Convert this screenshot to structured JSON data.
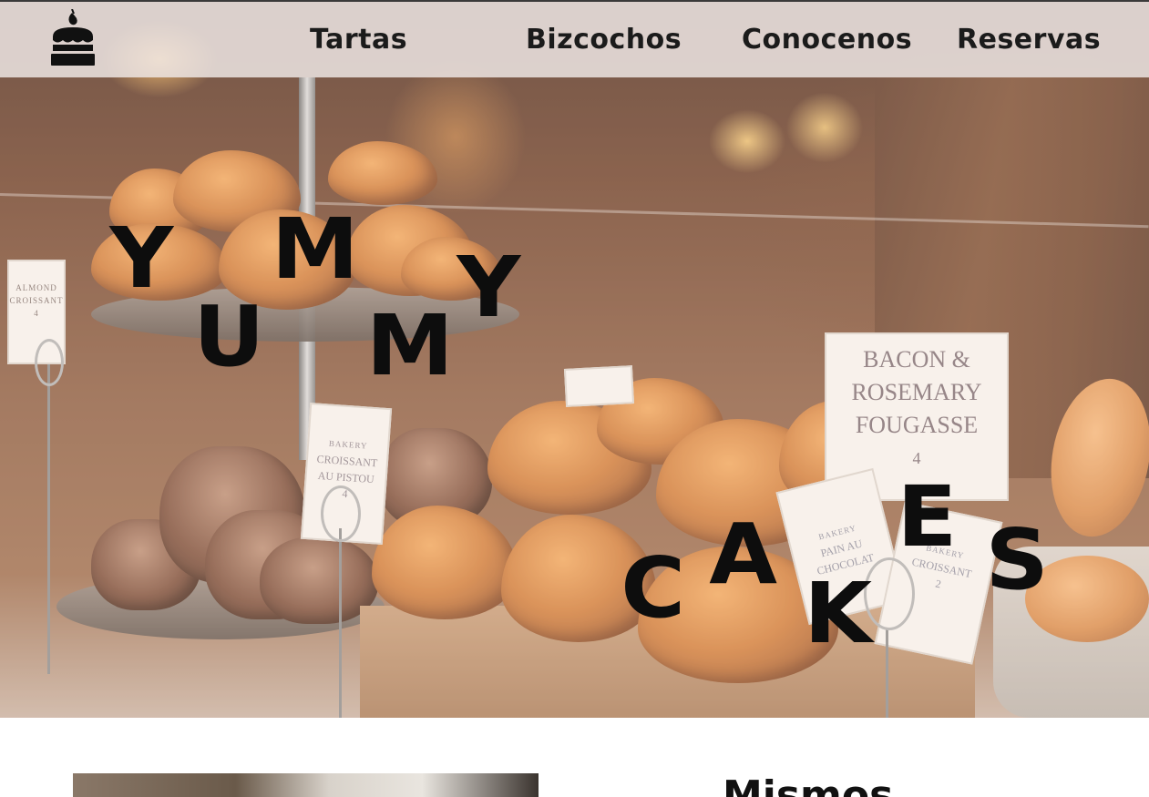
{
  "nav": {
    "logo_icon": "cake-icon",
    "links": [
      "Tartas",
      "Bizcochos",
      "Conocenos",
      "Reservas"
    ]
  },
  "hero": {
    "word1_letters": [
      "Y",
      "U",
      "M",
      "M",
      "Y"
    ],
    "word2_letters": [
      "C",
      "A",
      "K",
      "E",
      "S"
    ],
    "signs": {
      "almond": [
        "ALMOND",
        "CROISSANT",
        "4"
      ],
      "pistou": [
        "BAKERY",
        "CROISSANT",
        "AU PISTOU",
        "4"
      ],
      "bacon": [
        "BACON &",
        "ROSEMARY",
        "FOUGASSE",
        "4"
      ],
      "pain": [
        "BAKERY",
        "PAIN AU",
        "CHOCOLAT"
      ],
      "croissant2": [
        "BAKERY",
        "CROISSANT",
        "2"
      ]
    }
  },
  "section": {
    "title": "Mismos"
  },
  "colors": {
    "nav_bg": "#ece4e2",
    "text_dark": "#1b1b1b",
    "hero_letter": "#0d0d0d"
  }
}
